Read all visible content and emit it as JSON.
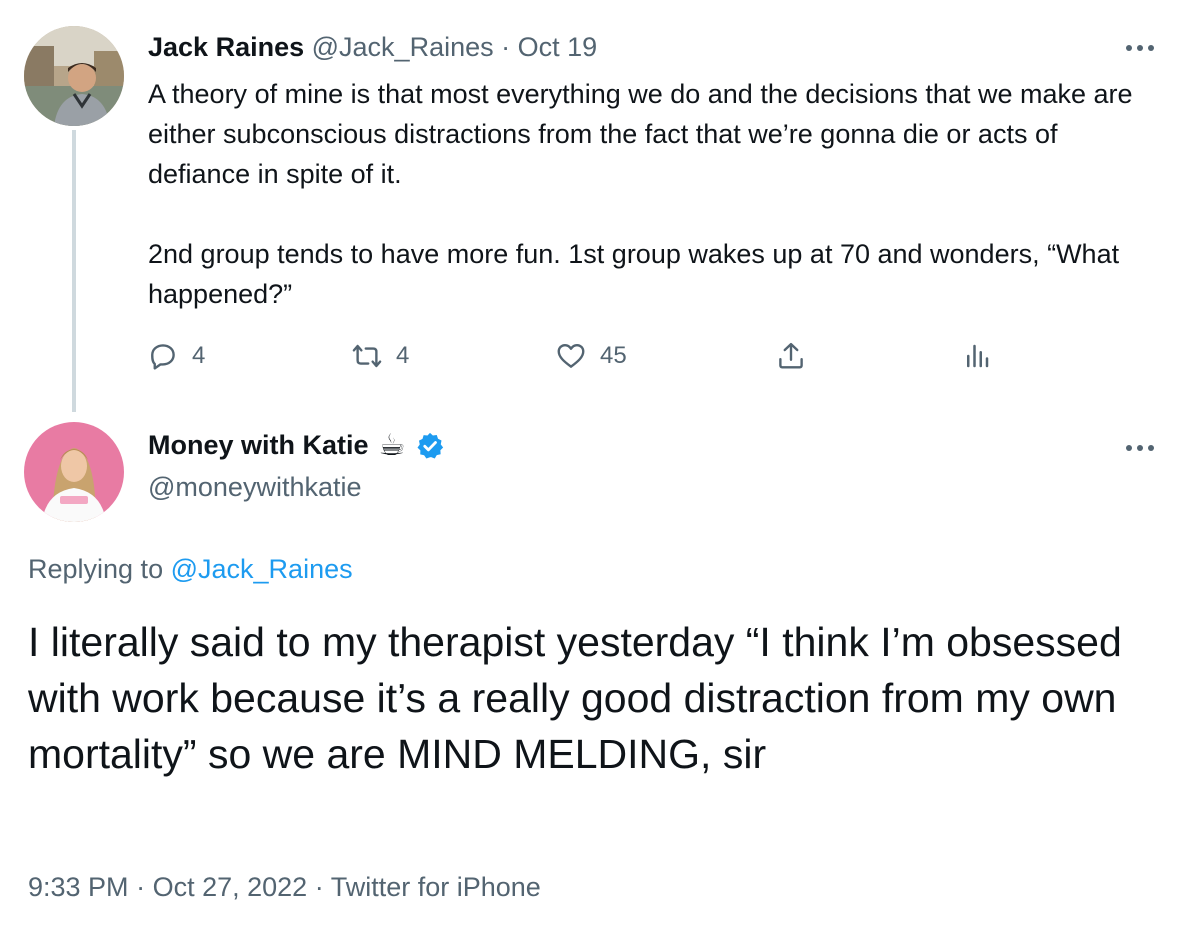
{
  "tweet_original": {
    "display_name": "Jack Raines",
    "handle": "@Jack_Raines",
    "separator": "·",
    "date": "Oct 19",
    "body_p1": "A theory of mine is that most everything we do and the decisions that we make are either subconscious distractions from the fact that we’re gonna die or acts of defiance in spite of it.",
    "body_p2": "2nd group tends to have more fun. 1st group wakes up at 70 and wonders, “What happened?”",
    "reply_count": "4",
    "retweet_count": "4",
    "like_count": "45",
    "more_icon": "more-horizontal-icon"
  },
  "tweet_reply": {
    "display_name": "Money with Katie",
    "emoji": "☕",
    "verified": true,
    "handle": "@moneywithkatie",
    "replying_prefix": "Replying to",
    "replying_handle": "@Jack_Raines",
    "body": "I literally said to my therapist yesterday “I think I’m obsessed with work because it’s a really good distraction from my own mortality” so we are MIND MELDING, sir",
    "time": "9:33 PM",
    "date": "Oct 27, 2022",
    "source": "Twitter for iPhone",
    "sep": "·",
    "more_icon": "more-horizontal-icon"
  },
  "colors": {
    "text": "#0f1419",
    "muted": "#536471",
    "link": "#1d9bf0",
    "verified": "#1d9bf0",
    "thread_line": "#cfd9de"
  }
}
